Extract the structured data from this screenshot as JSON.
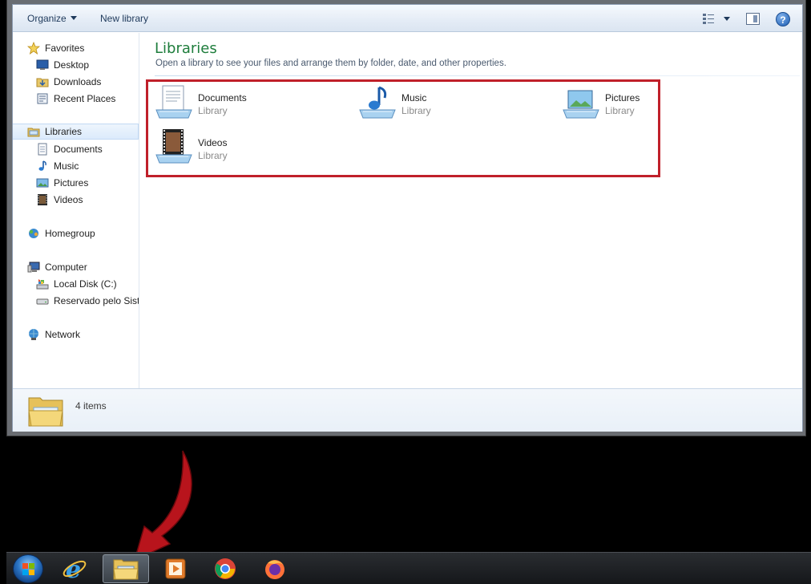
{
  "toolbar": {
    "organize_label": "Organize",
    "new_library_label": "New library",
    "help_label": "?"
  },
  "nav": {
    "favorites": "Favorites",
    "desktop": "Desktop",
    "downloads": "Downloads",
    "recent_places": "Recent Places",
    "libraries": "Libraries",
    "documents": "Documents",
    "music": "Music",
    "pictures": "Pictures",
    "videos": "Videos",
    "homegroup": "Homegroup",
    "computer": "Computer",
    "local_disk": "Local Disk (C:)",
    "reserved": "Reservado pelo Siste",
    "network": "Network"
  },
  "content": {
    "heading": "Libraries",
    "subheading": "Open a library to see your files and arrange them by folder, date, and other properties.",
    "libraries": [
      {
        "name": "Documents",
        "type": "Library",
        "icon": "documents-library-icon"
      },
      {
        "name": "Music",
        "type": "Library",
        "icon": "music-library-icon"
      },
      {
        "name": "Pictures",
        "type": "Library",
        "icon": "pictures-library-icon"
      },
      {
        "name": "Videos",
        "type": "Library",
        "icon": "videos-library-icon"
      }
    ]
  },
  "details": {
    "count": "4 items"
  },
  "taskbar": {
    "items": [
      "start-orb-icon",
      "internet-explorer-icon",
      "windows-explorer-icon",
      "media-player-icon",
      "chrome-icon",
      "firefox-icon"
    ]
  },
  "colors": {
    "heading": "#1e7d3c",
    "highlight": "#c0202a",
    "arrow": "#c0202a"
  }
}
